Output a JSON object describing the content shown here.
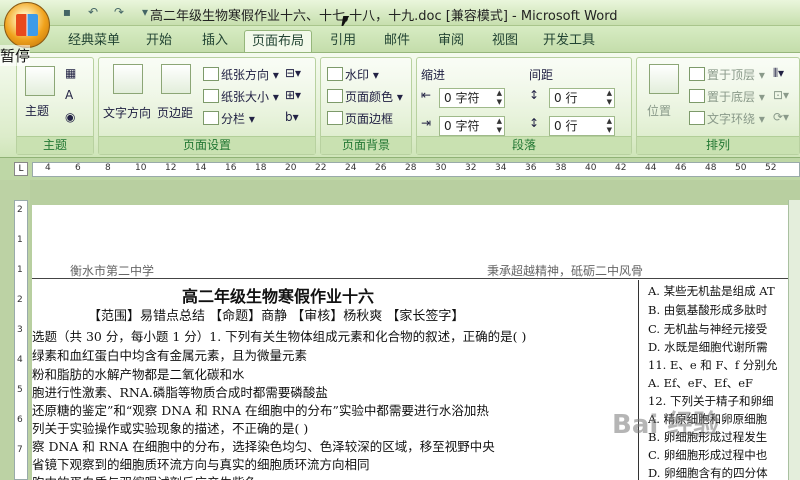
{
  "window": {
    "title": "高二年级生物寒假作业十六、十七,十八，十九.doc [兼容模式] - Microsoft Word",
    "overlay_text": "暂停"
  },
  "tabs": [
    "经典菜单",
    "开始",
    "插入",
    "页面布局",
    "引用",
    "邮件",
    "审阅",
    "视图",
    "开发工具"
  ],
  "ribbon": {
    "theme": {
      "label": "主题",
      "btn": "主题"
    },
    "page_setup": {
      "label": "页面设置",
      "text_dir": "文字方向",
      "margins": "页边距",
      "orientation": "纸张方向",
      "size": "纸张大小",
      "columns": "分栏"
    },
    "page_bg": {
      "label": "页面背景",
      "watermark": "水印",
      "page_color": "页面颜色",
      "page_border": "页面边框"
    },
    "paragraph": {
      "label": "段落",
      "indent": "缩进",
      "spacing": "间距",
      "indent_left": "0 字符",
      "indent_right": "0 字符",
      "space_before": "0 行",
      "space_after": "0 行"
    },
    "arrange": {
      "label": "排列",
      "position": "位置",
      "bring_front": "置于顶层",
      "send_back": "置于底层",
      "wrap": "文字环绕"
    }
  },
  "ruler": {
    "corner": "L",
    "ticks": [
      "4",
      "6",
      "8",
      "10",
      "12",
      "14",
      "16",
      "18",
      "20",
      "22",
      "24",
      "26",
      "28",
      "30",
      "32",
      "34",
      "36",
      "38",
      "40",
      "42",
      "44",
      "46",
      "48",
      "50",
      "52"
    ],
    "vticks": [
      "2",
      "1",
      "1",
      "2",
      "3",
      "4",
      "5",
      "6",
      "7"
    ]
  },
  "document": {
    "header_left": "衡水市第二中学",
    "header_right": "秉承超越精神，砥砺二中风骨",
    "title": "高二年级生物寒假作业十六",
    "meta": "【范围】易错点总结  【命题】商静  【审核】杨秋爽  【家长签字】",
    "lines": [
      "选题（共 30 分，每小题 1 分）1. 下列有关生物体组成元素和化合物的叙述，正确的是(    )",
      "绿素和血红蛋白中均含有金属元素，且为微量元素",
      "粉和脂肪的水解产物都是二氧化碳和水",
      "胞进行性激素、RNA.磷脂等物质合成时都需要磷酸盐",
      "还原糖的鉴定”和“观察 DNA 和 RNA 在细胞中的分布”实验中都需要进行水浴加热",
      "列关于实验操作或实验现象的描述，不正确的是(          )",
      "察 DNA 和 RNA 在细胞中的分布，选择染色均匀、色泽较深的区域，移至视野中央",
      "省镜下观察到的细胞质环流方向与真实的细胞质环流方向相同",
      "胞中的蛋白质与双缩脲试剂反应产生紫色"
    ],
    "right_lines": [
      "A. 某些无机盐是组成 AT",
      "B. 由氨基酸形成多肽时",
      "C. 无机盐与神经元接受",
      "D. 水既是细胞代谢所需",
      "11. E、e 和 F、f 分别允",
      "A. Ef、eF、Ef、eF",
      "12. 下列关于精子和卵细",
      "A. 精原细胞和卵原细胞",
      "B. 卵细胞形成过程发生",
      "C. 卵细胞形成过程中也",
      "D. 卵细胞含有的四分体"
    ],
    "watermark": "Bai 经验"
  }
}
